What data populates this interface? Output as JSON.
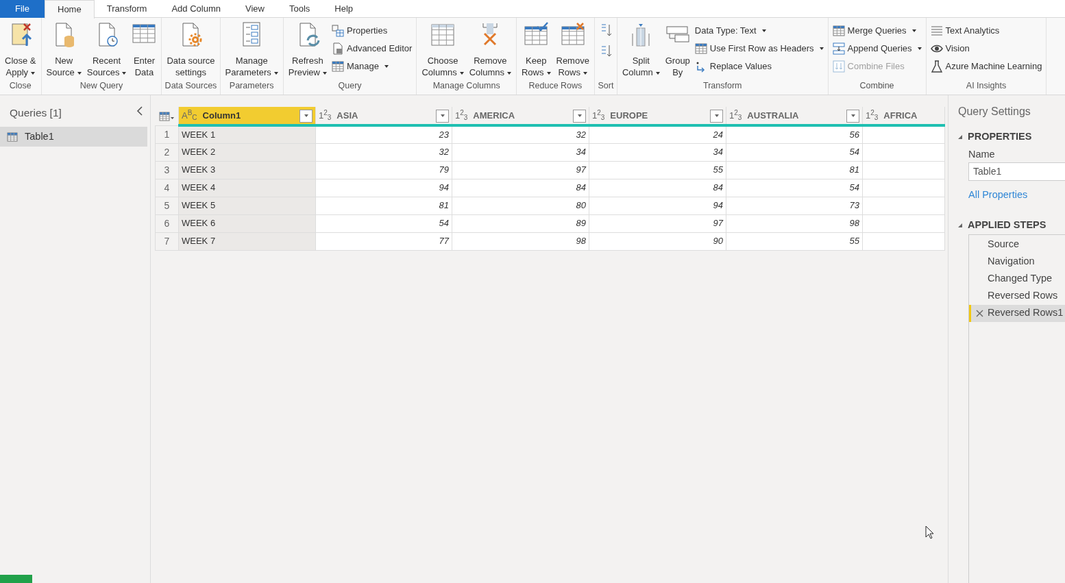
{
  "menu_tabs": [
    {
      "label": "File",
      "kind": "file",
      "selected": false
    },
    {
      "label": "Home",
      "kind": "tab",
      "selected": true
    },
    {
      "label": "Transform",
      "kind": "tab",
      "selected": false
    },
    {
      "label": "Add Column",
      "kind": "tab",
      "selected": false
    },
    {
      "label": "View",
      "kind": "tab",
      "selected": false
    },
    {
      "label": "Tools",
      "kind": "tab",
      "selected": false
    },
    {
      "label": "Help",
      "kind": "tab",
      "selected": false
    }
  ],
  "ribbon_groups": [
    {
      "label": "Close",
      "items": [
        {
          "kind": "large",
          "label": "Close &\nApply",
          "dropdown": true
        }
      ]
    },
    {
      "label": "New Query",
      "items": [
        {
          "kind": "large",
          "label": "New\nSource",
          "dropdown": true
        },
        {
          "kind": "large",
          "label": "Recent\nSources",
          "dropdown": true
        },
        {
          "kind": "large",
          "label": "Enter\nData",
          "dropdown": false
        }
      ]
    },
    {
      "label": "Data Sources",
      "items": [
        {
          "kind": "large",
          "label": "Data source\nsettings",
          "dropdown": false
        }
      ]
    },
    {
      "label": "Parameters",
      "items": [
        {
          "kind": "large",
          "label": "Manage\nParameters",
          "dropdown": true
        }
      ]
    },
    {
      "label": "Query",
      "items": [
        {
          "kind": "large",
          "label": "Refresh\nPreview",
          "dropdown": true
        },
        {
          "kind": "stack",
          "items": [
            {
              "label": "Properties",
              "dropdown": false
            },
            {
              "label": "Advanced Editor",
              "dropdown": false
            },
            {
              "label": "Manage",
              "dropdown": true
            }
          ]
        }
      ]
    },
    {
      "label": "Manage Columns",
      "items": [
        {
          "kind": "large",
          "label": "Choose\nColumns",
          "dropdown": true
        },
        {
          "kind": "large",
          "label": "Remove\nColumns",
          "dropdown": true
        }
      ]
    },
    {
      "label": "Reduce Rows",
      "items": [
        {
          "kind": "large",
          "label": "Keep\nRows",
          "dropdown": true
        },
        {
          "kind": "large",
          "label": "Remove\nRows",
          "dropdown": true
        }
      ]
    },
    {
      "label": "Sort",
      "items": [
        {
          "kind": "icons"
        }
      ]
    },
    {
      "label": "Transform",
      "items": [
        {
          "kind": "large",
          "label": "Split\nColumn",
          "dropdown": true
        },
        {
          "kind": "large",
          "label": "Group\nBy",
          "dropdown": false
        },
        {
          "kind": "stack",
          "items": [
            {
              "label": "Data Type: Text",
              "dropdown": true
            },
            {
              "label": "Use First Row as Headers",
              "dropdown": true
            },
            {
              "label": "Replace Values",
              "dropdown": false
            }
          ]
        }
      ]
    },
    {
      "label": "Combine",
      "items": [
        {
          "kind": "stack",
          "items": [
            {
              "label": "Merge Queries",
              "dropdown": true,
              "disabled": false
            },
            {
              "label": "Append Queries",
              "dropdown": true,
              "disabled": false
            },
            {
              "label": "Combine Files",
              "dropdown": false,
              "disabled": true
            }
          ]
        }
      ]
    },
    {
      "label": "AI Insights",
      "items": [
        {
          "kind": "stack",
          "items": [
            {
              "label": "Text Analytics",
              "dropdown": false
            },
            {
              "label": "Vision",
              "dropdown": false
            },
            {
              "label": "Azure Machine Learning",
              "dropdown": false
            }
          ]
        }
      ]
    }
  ],
  "queries_panel": {
    "title": "Queries [1]",
    "items": [
      {
        "label": "Table1",
        "selected": true
      }
    ]
  },
  "table": {
    "columns": [
      {
        "type_glyph": "A$^{B}$$_{C}$",
        "label": "Column1",
        "selected": true,
        "filter": true
      },
      {
        "type_glyph": "1$^{2}$$_{3}$",
        "label": "ASIA",
        "selected": false,
        "filter": true
      },
      {
        "type_glyph": "1$^{2}$$_{3}$",
        "label": "AMERICA",
        "selected": false,
        "filter": true
      },
      {
        "type_glyph": "1$^{2}$$_{3}$",
        "label": "EUROPE",
        "selected": false,
        "filter": true
      },
      {
        "type_glyph": "1$^{2}$$_{3}$",
        "label": "AUSTRALIA",
        "selected": false,
        "filter": true
      },
      {
        "type_glyph": "1$^{2}$$_{3}$",
        "label": "AFRICA",
        "selected": false,
        "filter": false
      }
    ],
    "rows": [
      {
        "number": "1",
        "cells": [
          "WEEK 1",
          "23",
          "32",
          "24",
          "56"
        ]
      },
      {
        "number": "2",
        "cells": [
          "WEEK 2",
          "32",
          "34",
          "34",
          "54"
        ]
      },
      {
        "number": "3",
        "cells": [
          "WEEK 3",
          "79",
          "97",
          "55",
          "81"
        ]
      },
      {
        "number": "4",
        "cells": [
          "WEEK 4",
          "94",
          "84",
          "84",
          "54"
        ]
      },
      {
        "number": "5",
        "cells": [
          "WEEK 5",
          "81",
          "80",
          "94",
          "73"
        ]
      },
      {
        "number": "6",
        "cells": [
          "WEEK 6",
          "54",
          "89",
          "97",
          "98"
        ]
      },
      {
        "number": "7",
        "cells": [
          "WEEK 7",
          "77",
          "98",
          "90",
          "55"
        ]
      }
    ]
  },
  "query_settings": {
    "title": "Query Settings",
    "properties": {
      "heading": "PROPERTIES",
      "expanded": true,
      "name_label": "Name",
      "name_value": "Table1",
      "link": "All Properties"
    },
    "applied_steps": {
      "heading": "APPLIED STEPS",
      "expanded": true,
      "steps": [
        {
          "label": "Source",
          "selected": false
        },
        {
          "label": "Navigation",
          "selected": false
        },
        {
          "label": "Changed Type",
          "selected": false
        },
        {
          "label": "Reversed Rows",
          "selected": false
        },
        {
          "label": "Reversed Rows1",
          "selected": true
        }
      ]
    }
  }
}
